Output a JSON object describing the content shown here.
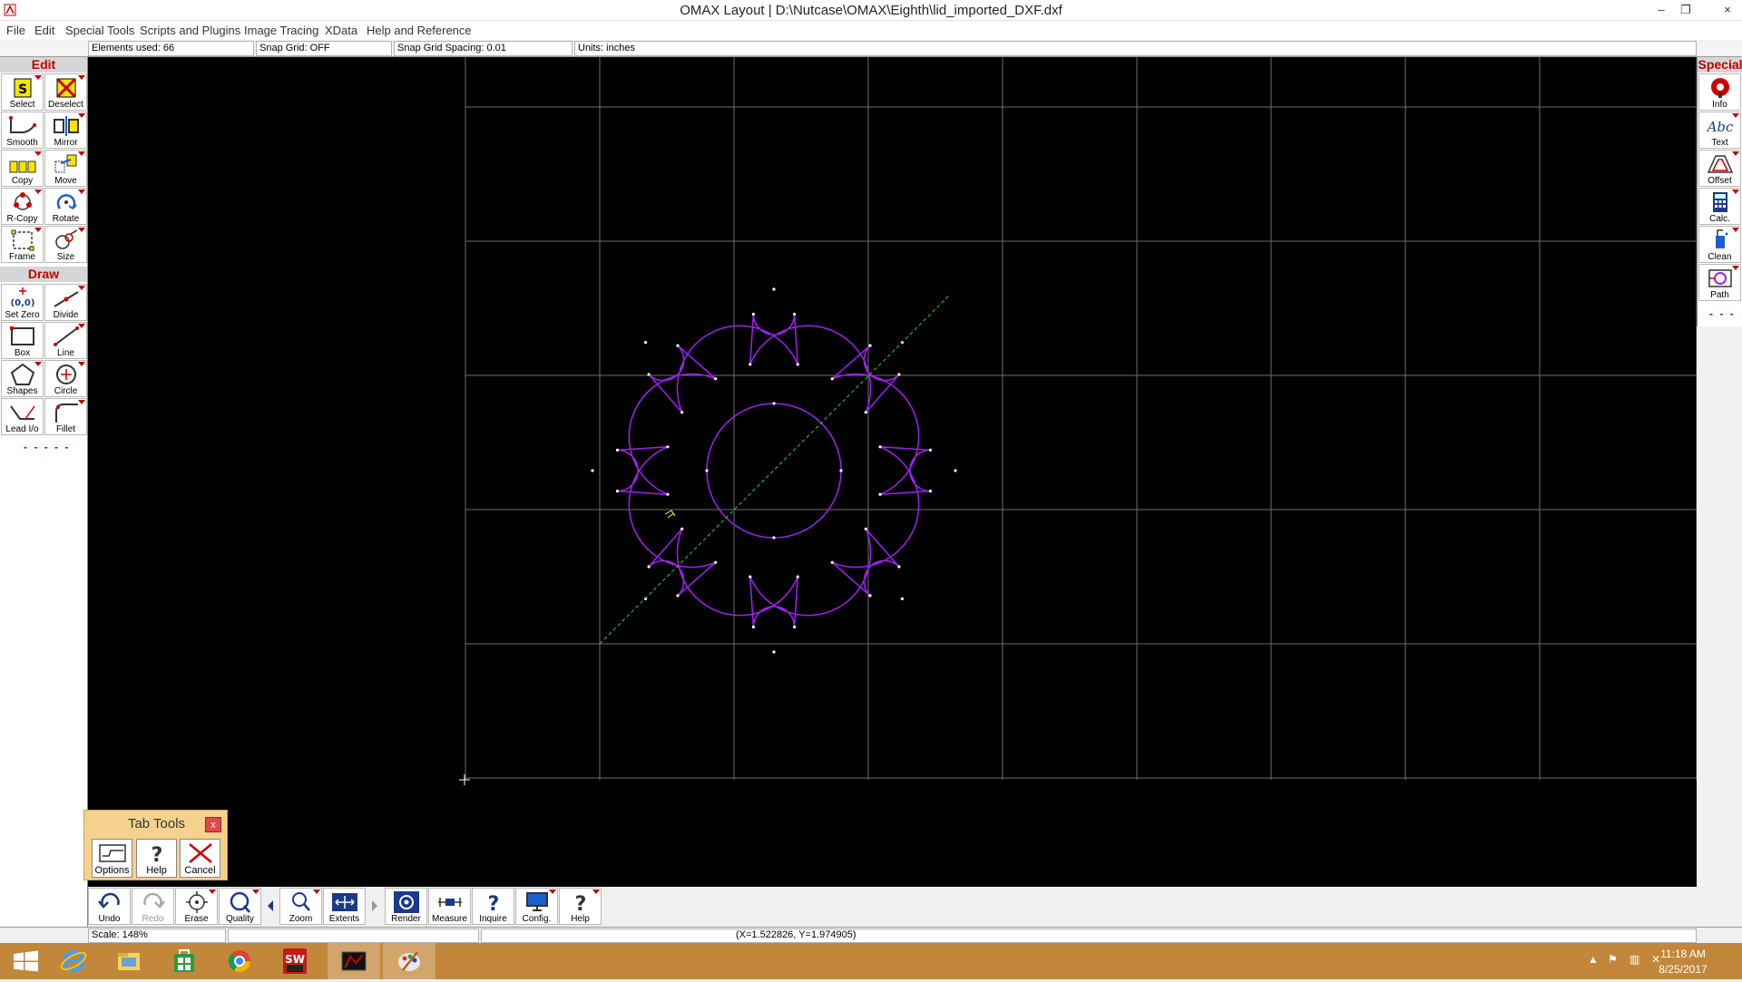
{
  "window": {
    "title": "OMAX Layout | D:\\Nutcase\\OMAX\\Eighth\\lid_imported_DXF.dxf",
    "minimize": "–",
    "restore": "❐",
    "close": "×"
  },
  "menu": [
    "File",
    "Edit",
    "Special Tools",
    "Scripts and Plugins",
    "Image Tracing",
    "XData",
    "Help and Reference"
  ],
  "status": {
    "elements_used": "Elements used: 66",
    "snap_grid": "Snap Grid: OFF",
    "snap_spacing": "Snap Grid Spacing: 0.01",
    "units": "Units: inches"
  },
  "left_panel": {
    "edit_header": "Edit",
    "edit_tools": [
      "Select",
      "Deselect",
      "Smooth",
      "Mirror",
      "Copy",
      "Move",
      "R-Copy",
      "Rotate",
      "Frame",
      "Size"
    ],
    "draw_header": "Draw",
    "draw_tools": [
      "Set Zero",
      "Divide",
      "Box",
      "Line",
      "Shapes",
      "Circle",
      "Lead I/o",
      "Fillet"
    ],
    "dashes": "- - - - -"
  },
  "right_panel": {
    "header": "Special",
    "tools": [
      "Info",
      "Text",
      "Offset",
      "Calc.",
      "Clean",
      "Path"
    ],
    "dashes": "- - -"
  },
  "tab_tools": {
    "title": "Tab Tools",
    "close": "x",
    "buttons": [
      "Options",
      "Help",
      "Cancel"
    ]
  },
  "bottom_toolbar": [
    "Undo",
    "Redo",
    "Erase",
    "Quality",
    "Zoom",
    "Extents",
    "Render",
    "Measure",
    "Inquire",
    "Config.",
    "Help"
  ],
  "bottom_status": {
    "scale": "Scale: 148%",
    "coords": "(X=1.522826, Y=1.974905)"
  },
  "taskbar": {
    "time": "11:18 AM",
    "date": "8/25/2017",
    "apps": [
      "windows-start",
      "internet-explorer",
      "file-explorer",
      "store",
      "chrome",
      "solidworks-2016",
      "omax-layout",
      "paint"
    ]
  },
  "colors": {
    "canvas": "#000000",
    "grid": "#6e6e6e",
    "part_outline": "#a020f0",
    "vertex": "#ffffff",
    "guide_line": "#30d030",
    "panel_header_text": "#c00000",
    "taskbar": "#c2873a",
    "tab_tools_bg": "#f5d18e"
  }
}
